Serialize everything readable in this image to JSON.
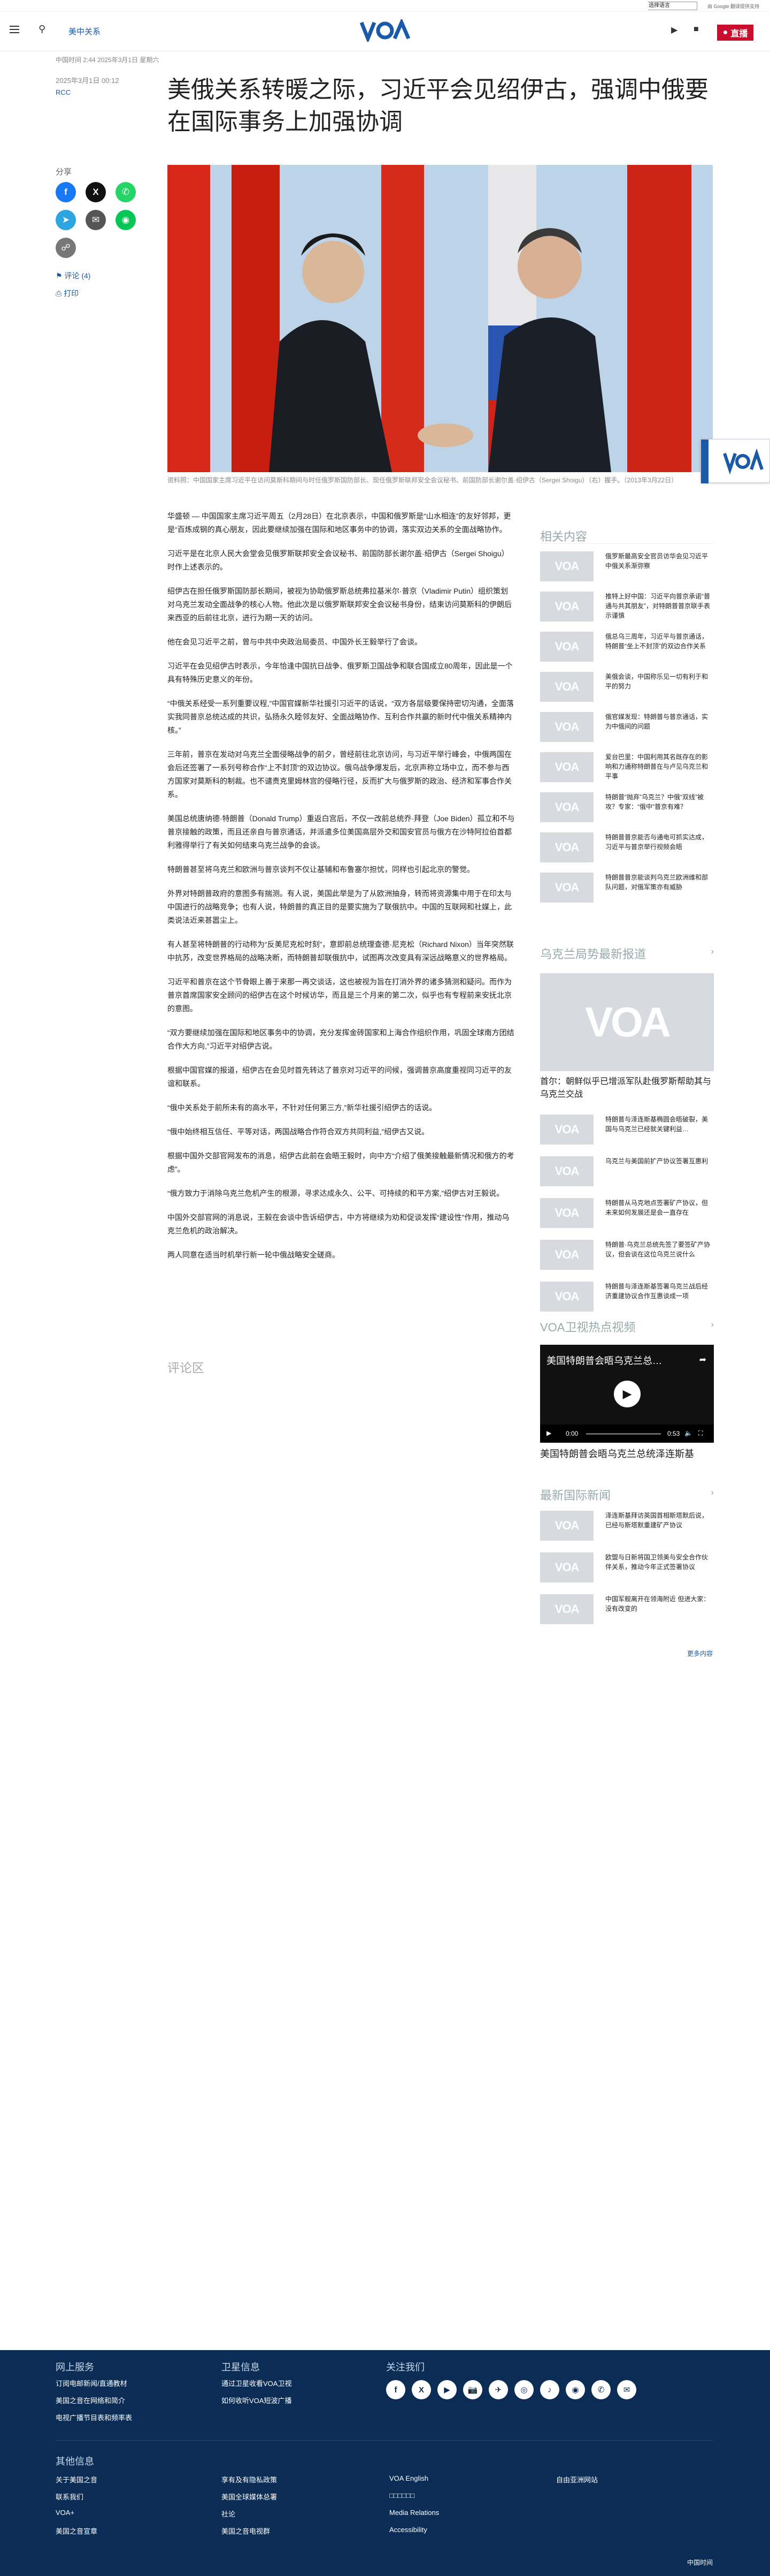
{
  "topbar": {
    "lang_select_1": "选择语言",
    "lang_select_2": "选择语言",
    "google_translate": "由 Google 翻译提供支持"
  },
  "header": {
    "section": "美中关系",
    "logo": "VOA",
    "live_label": "直播"
  },
  "article": {
    "meta_line": "中国时间 2:44 2025年3月1日 星期六",
    "date": "2025年3月1日 00:12",
    "category": "RCC",
    "title": "美俄关系转暖之际，习近平会见绍伊古，强调中俄要在国际事务上加强协调",
    "caption": "资料照：中国国家主席习近平在访问莫斯科期间与时任俄罗斯国防部长、现任俄罗斯联邦安全会议秘书、前国防部长谢尔盖·绍伊古（Sergei Shoigu）（右）握手。（2013年3月22日）",
    "paragraphs": [
      "华盛顿 — 中国国家主席习近平周五（2月28日）在北京表示，中国和俄罗斯是“山水相连”的友好邻邦，更是“百炼成钢的真心朋友，因此要继续加强在国际和地区事务中的协调，落实双边关系的全面战略协作。",
      "习近平是在北京人民大会堂会见俄罗斯联邦安全会议秘书、前国防部长谢尔盖·绍伊古（Sergei Shoigu）时作上述表示的。",
      "绍伊古在担任俄罗斯国防部长期间，被视为协助俄罗斯总统弗拉基米尔·普京（Vladimir Putin）组织策划对乌克兰发动全面战争的核心人物。他此次是以俄罗斯联邦安全会议秘书身份，结束访问莫斯科的伊朗后来西亚的后前往北京，进行为期一天的访问。",
      "他在会见习近平之前，曾与中共中央政治局委员、中国外长王毅举行了会谈。",
      "习近平在会见绍伊古时表示，今年恰逢中国抗日战争、俄罗斯卫国战争和联合国成立80周年，因此是一个具有特殊历史意义的年份。",
      "“中俄关系经受一系列重要议程,”中国官媒新华社援引习近平的话说，“双方各层级要保持密切沟通，全面落实我同普京总统达成的共识，弘扬永久睦邻友好、全面战略协作、互利合作共赢的新时代中俄关系精神内核。”",
      "三年前，普京在发动对乌克兰全面侵略战争的前夕，曾经前往北京访问，与习近平举行峰会，中俄两国在会后还签署了一系列号称合作“上不封顶”的双边协议。俄乌战争爆发后，北京声称立场中立，而不参与西方国家对莫斯科的制裁。也不谴责克里姆林宫的侵略行径，反而扩大与俄罗斯的政治、经济和军事合作关系。",
      "美国总统唐纳德·特朗普（Donald Trump）重返白宫后，不仅一改前总统乔·拜登（Joe Biden）孤立和不与普京接触的政策，而且还亲自与普京通话，并派遣多位美国高层外交和国安官员与俄方在沙特阿拉伯首都利雅得举行了有关如何结束乌克兰战争的会谈。",
      "特朗普甚至将乌克兰和欧洲与普京谈判不仅让基辅和布鲁塞尔担忧，同样也引起北京的警觉。",
      "外界对特朗普政府的意图多有揣测。有人说，美国此举是为了从欧洲抽身，转而将资源集中用于在印太与中国进行的战略竞争；也有人说，特朗普的真正目的是要实施为了联俄抗中。中国的互联网和社媒上，此类说法近来甚嚣尘上。",
      "有人甚至将特朗普的行动称为“反美尼克松时刻”，意即前总统理查德·尼克松（Richard Nixon）当年突然联中抗苏，改变世界格局的战略决断，而特朗普却联俄抗中，试图再次改变具有深远战略意义的世界格局。",
      "习近平和普京在这个节骨眼上善于来那一再交谈话，这也被视为旨在打消外界的诸多猜测和疑问。而作为普京首席国家安全顾问的绍伊古在这个时候访华，而且是三个月来的第二次，似乎也有专程前来安抚北京的意图。",
      "“双方要继续加强在国际和地区事务中的协调，充分发挥金砖国家和上海合作组织作用，巩固全球南方团结合作大方向,”习近平对绍伊古说。",
      "根据中国官媒的报道，绍伊古在会见时首先转达了普京对习近平的问候，强调普京高度重视同习近平的友谊和联系。",
      "“俄中关系处于前所未有的高水平，不针对任何第三方,”新华社援引绍伊古的话说。",
      "“俄中始终相互信任、平等对话，两国战略合作符合双方共同利益,”绍伊古又说。",
      "根据中国外交部官网发布的消息，绍伊古此前在会晤王毅时，向中方“介绍了俄美接触最新情况和俄方的考虑”。",
      "“俄方致力于消除乌克兰危机产生的根源，寻求达成永久、公平、可持续的和平方案,”绍伊古对王毅说。",
      "中国外交部官网的消息说，王毅在会谈中告诉绍伊古，中方将继续为劝和促谈发挥“建设性”作用，推动乌克兰危机的政治解决。",
      "两人同意在适当时机举行新一轮中俄战略安全磋商。"
    ],
    "comments_label": "评论区"
  },
  "share": {
    "label": "分享",
    "comments_link": "评论 (4)",
    "print_link": "打印"
  },
  "sidebar": {
    "related_heading": "相关内容",
    "related": [
      "俄罗斯最高安全官员访华会见习近平 中俄关系渐弥察",
      "推特上好中国：习近平向普京承诺“普通与共其朋友”，对特朗普普京联手表示谨慎",
      "俄总乌三周年，习近平与普京通话，特朗普“坐上不封顶”的双边合作关系",
      "美俄会谈，中国称乐见一切有利于和平的努力",
      "俄官媒发现：特朗普与普京通话，实为中俄间的问题",
      "爱台巴里：中国利用其名既存在的影响和力通称特朗普在与卢见乌克兰和平事",
      "特朗普“抛弃”乌克兰？中俄“双线”被攻？专家：“俄中”普京有难？",
      "特朗普普京能否与通电可抓实达成，习近平与普京举行视频会晤",
      "特朗普普京能谈判乌克兰欧洲维和部队问题，对俄军策亦有威胁",
      "中国从美国对俄受害的和解中得到好处，对俄军策亦有威胁"
    ],
    "ukraine_heading": "乌克兰局势最新报道",
    "ukraine_big": "首尔：朝鲜似乎已增派军队赴俄罗斯帮助其与乌克兰交战",
    "ukraine_list": [
      "特朗普与泽连斯基椭圆会晤破裂，美国与乌克兰已经就关键利益…",
      "乌克兰与美国前扩产协议签署互惠利",
      "特朗普从马克地点签署矿产协议，但未来如何发展还是会一直存在",
      "特朗普·乌克兰总统先签了要签矿产协议，但会谈在这位乌克兰说什么",
      "特朗普与泽连斯基签署乌克兰战后经济重建协议合作互惠谈成一项"
    ],
    "video_heading": "VOA卫视热点视频",
    "video_title": "美国特朗普会晤乌克兰总…",
    "video_time": "0:00",
    "video_duration": "0:53",
    "video_caption": "美国特朗普会晤乌克兰总统泽连斯基",
    "intl_heading": "最新国际新闻",
    "intl_list": [
      "泽连斯基拜访英国首相斯塔默后说，已经与斯塔默重建矿产协议",
      "欧盟与日新将国卫领美与安全合作伙伴关系，推动今年正式签署协议",
      "中国军舰离开在领海附近 但进大家：没有改变的"
    ],
    "more_news": "更多内容"
  },
  "footer": {
    "online_heading": "网上服务",
    "online_links": [
      "订阅电邮新闻/直通教材",
      "美国之音在网络和简介",
      "电视广播节目表和频率表"
    ],
    "satellite_heading": "卫星信息",
    "satellite_links": [
      "通过卫星收看VOA卫视",
      "如何收听VOA短波广播"
    ],
    "follow_heading": "关注我们",
    "social_icons": [
      "f",
      "X",
      "▶",
      "📷",
      "✈",
      "◎",
      "♪",
      "◉",
      "✆",
      "✉"
    ],
    "other_heading": "其他信息",
    "other_col1": [
      "关于美国之音",
      "联系我们",
      "VOA+",
      "美国之音宣章"
    ],
    "other_col2": [
      "享有及有隐私政策",
      "美国全球媒体总署",
      "社论",
      "美国之音电视群"
    ],
    "other_col3": [
      "VOA English",
      "□□□□□□",
      "Media Relations",
      "Accessibility"
    ],
    "other_col4": [
      "自由亚洲网站"
    ],
    "copyright": "中国时间"
  }
}
